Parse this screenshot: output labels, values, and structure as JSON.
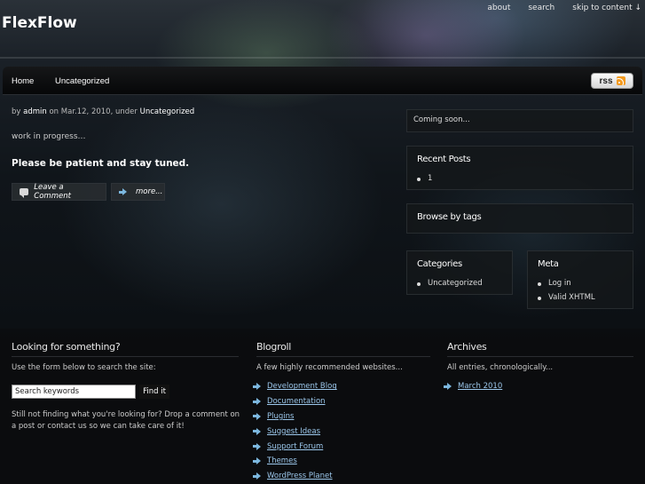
{
  "site": {
    "title": "FlexFlow"
  },
  "top_nav": [
    "about",
    "search",
    "skip to content ↓"
  ],
  "main_nav": {
    "items": [
      "Home",
      "Uncategorized"
    ],
    "rss_label": "rss"
  },
  "post": {
    "meta_prefix": "by",
    "author": "admin",
    "meta_date": "on Mar.12, 2010, under",
    "category": "Uncategorized",
    "text": "work in progress…",
    "strong_text": "Please be patient and stay tuned.",
    "comment_button": "Leave a Comment",
    "more_button": "more..."
  },
  "sidebar": {
    "coming_soon": "Coming soon...",
    "recent_posts": {
      "title": "Recent Posts",
      "items": [
        "1"
      ]
    },
    "tags": {
      "title": "Browse by tags"
    },
    "categories": {
      "title": "Categories",
      "items": [
        "Uncategorized"
      ]
    },
    "meta": {
      "title": "Meta",
      "items": [
        "Log in",
        "Valid XHTML"
      ]
    }
  },
  "footer": {
    "search": {
      "title": "Looking for something?",
      "intro": "Use the form below to search the site:",
      "input_value": "Search keywords",
      "button": "Find it",
      "note": "Still not finding what you're looking for? Drop a comment on a post or contact us so we can take care of it!"
    },
    "blogroll": {
      "title": "Blogroll",
      "intro": "A few highly recommended websites...",
      "links": [
        "Development Blog",
        "Documentation",
        "Plugins",
        "Suggest Ideas",
        "Support Forum",
        "Themes",
        "WordPress Planet"
      ]
    },
    "archives": {
      "title": "Archives",
      "intro": "All entries, chronologically...",
      "links": [
        "March 2010"
      ]
    }
  },
  "colors": {
    "link": "#9cc8ec",
    "rss_orange": "#f39a1f",
    "arrow": "#7cb7de"
  }
}
